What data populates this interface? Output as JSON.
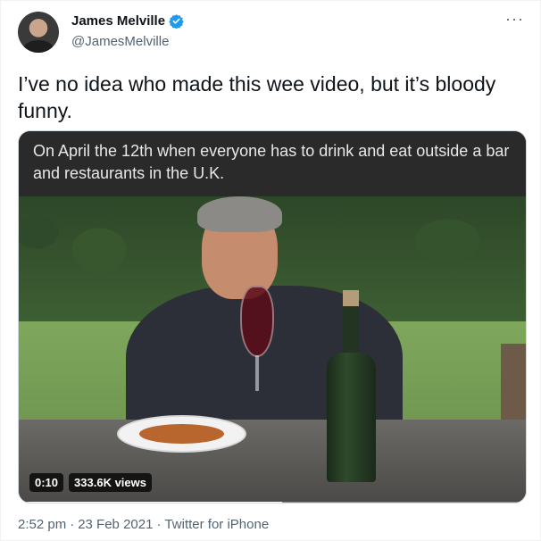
{
  "author": {
    "display_name": "James Melville",
    "handle": "@JamesMelville",
    "verified": true,
    "verified_color": "#1d9bf0"
  },
  "more_icon": "···",
  "tweet": {
    "text": "I’ve no idea who made this wee video, but it’s bloody funny."
  },
  "media": {
    "caption": "On April the 12th when everyone has to drink and eat outside a bar and restaurants in the U.K.",
    "duration": "0:10",
    "views": "333.6K views",
    "progress_fraction": 0.52
  },
  "meta": {
    "time": "2:52 pm",
    "separator1": "·",
    "date": "23 Feb 2021",
    "separator2": "·",
    "source": "Twitter for iPhone"
  }
}
